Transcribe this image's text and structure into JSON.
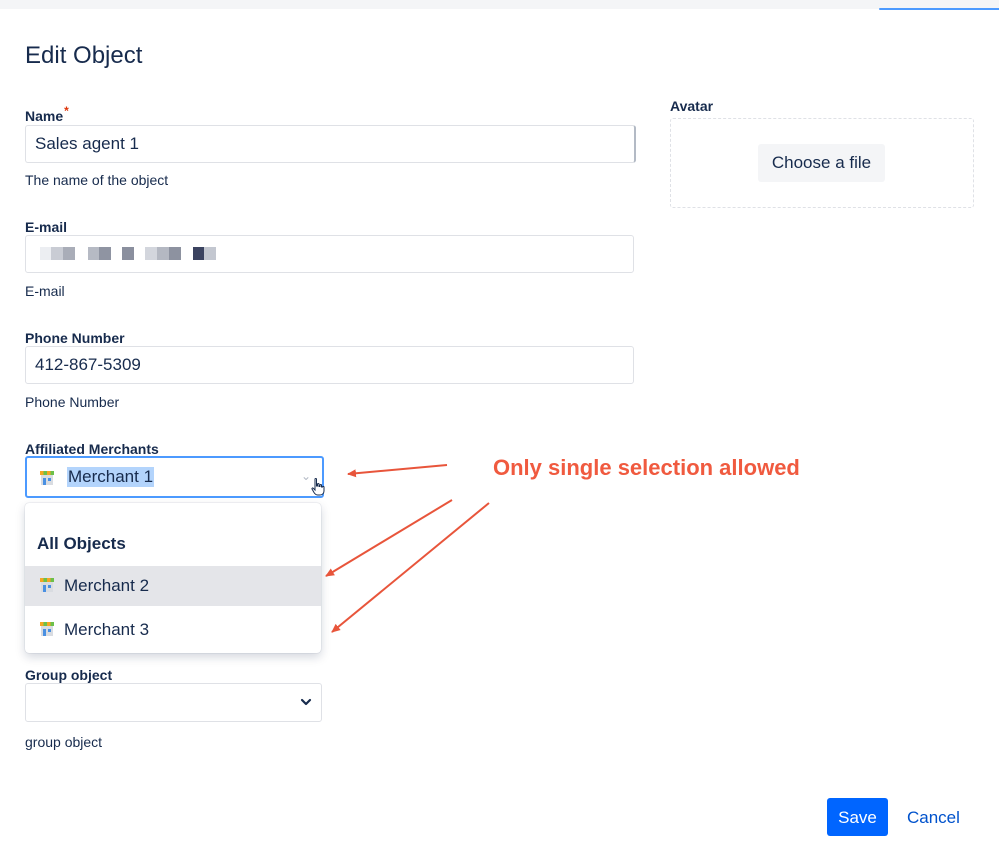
{
  "dialog": {
    "title": "Edit Object"
  },
  "name": {
    "label": "Name",
    "required_mark": "*",
    "value": "Sales agent 1",
    "help": "The name of the object"
  },
  "email": {
    "label": "E-mail",
    "help": "E-mail",
    "value_obscured": true
  },
  "phone": {
    "label": "Phone Number",
    "value": "412-867-5309",
    "help": "Phone Number"
  },
  "avatar": {
    "label": "Avatar",
    "button_label": "Choose a file"
  },
  "merchants": {
    "label": "Affiliated Merchants",
    "selected": "Merchant 1",
    "group_header": "All Objects",
    "options": [
      {
        "label": "Merchant 2",
        "icon": "shop-icon",
        "hovered": true
      },
      {
        "label": "Merchant 3",
        "icon": "shop-icon",
        "hovered": false
      }
    ]
  },
  "group_object": {
    "label": "Group object",
    "help": "group object"
  },
  "annotation": {
    "text": "Only single selection allowed",
    "color": "#f05a3f"
  },
  "footer": {
    "save_label": "Save",
    "cancel_label": "Cancel"
  },
  "colors": {
    "primary": "#0065ff",
    "link": "#0052cc",
    "focus_border": "#4c9aff",
    "text": "#172b4d",
    "required": "#de350b"
  }
}
